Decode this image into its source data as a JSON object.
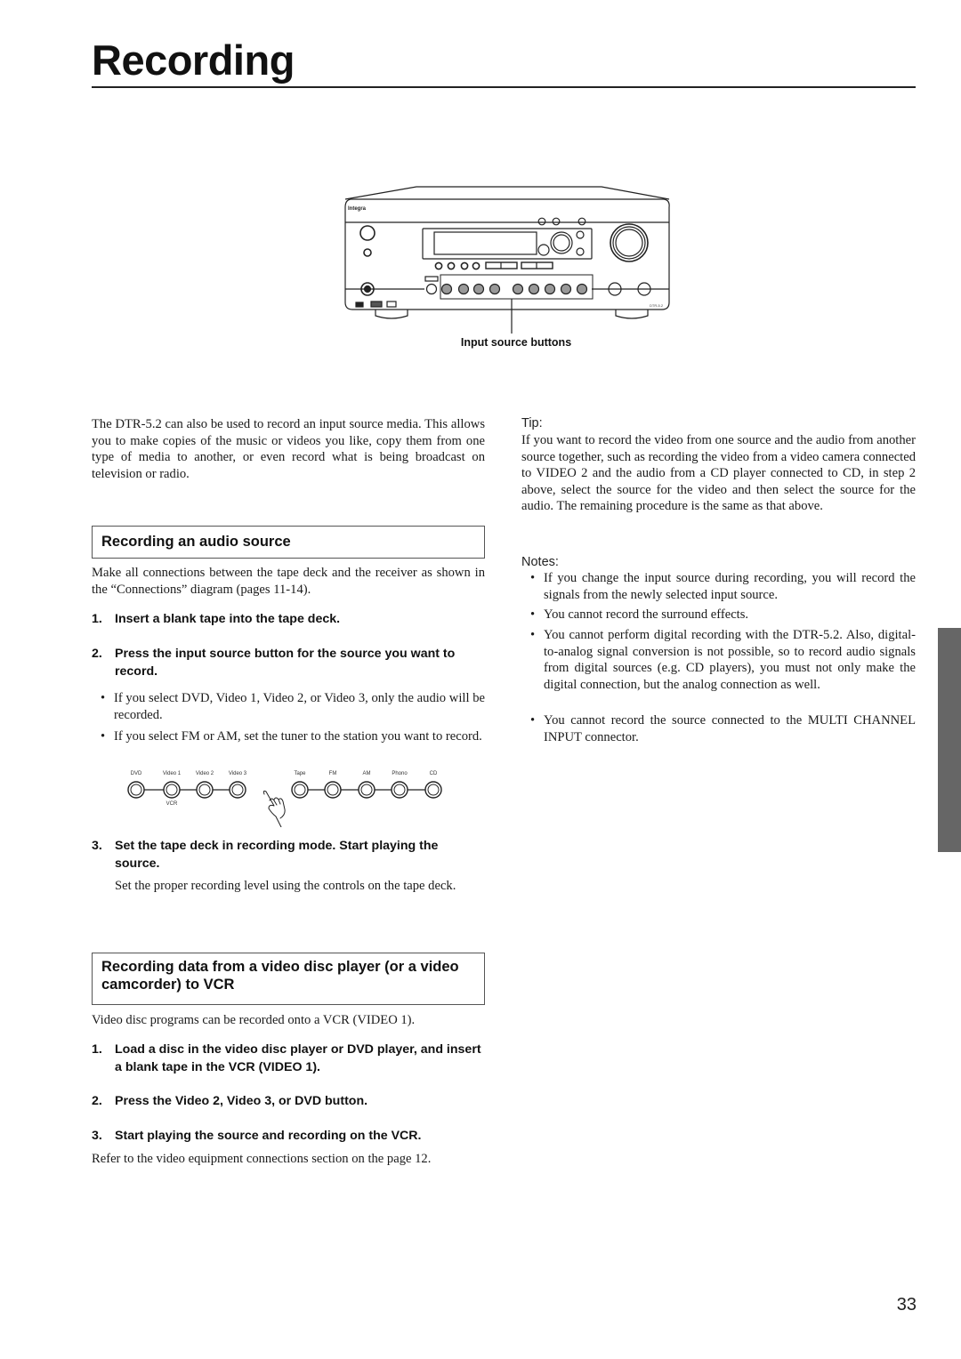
{
  "page": {
    "title": "Recording",
    "page_number": "33",
    "accent_tab_color": "#666666"
  },
  "figure_receiver": {
    "caption": "Input source buttons",
    "brand": "Integra",
    "model": "DTR-5.2",
    "input_buttons": [
      "DVD",
      "Video 1",
      "Video 2",
      "Video 3",
      "Tape",
      "FM",
      "AM",
      "Phono",
      "CD"
    ]
  },
  "intro": {
    "text": "The DTR-5.2 can also be used to record an input source media. This allows you to make copies of the music or videos you like, copy them from one type of media to another, or even record what is being broadcast on television or radio."
  },
  "section_audio": {
    "heading": "Recording an audio source",
    "intro": "Make all connections between the tape deck and the receiver as shown in the “Connections” diagram (pages 11-14).",
    "steps": [
      {
        "num": "1.",
        "text": "Insert a blank tape into the tape deck."
      },
      {
        "num": "2.",
        "text": "Press the input source button for the source you want to record."
      },
      {
        "num": "3.",
        "text": "Set the tape deck in recording mode. Start playing the source."
      }
    ],
    "step2_bullets": [
      "If you select DVD, Video 1, Video 2, or Video 3, only the audio will be recorded.",
      "If you select FM or AM, set the tuner to the station you want to record."
    ],
    "step3_detail": "Set the proper recording level using the controls on the tape deck.",
    "button_row": {
      "labels": [
        "DVD",
        "Video 1",
        "Video 2",
        "Video 3",
        "Tape",
        "FM",
        "AM",
        "Phono",
        "CD"
      ],
      "sublabel": "VCR"
    }
  },
  "section_video": {
    "heading": "Recording data from a video disc player (or a video camcorder) to VCR",
    "intro": "Video disc programs can be recorded onto a VCR (VIDEO 1).",
    "steps": [
      {
        "num": "1.",
        "text": "Load a disc in the video disc player or DVD player, and insert a blank tape in the VCR (VIDEO 1)."
      },
      {
        "num": "2.",
        "text": "Press the Video 2, Video 3, or DVD button."
      },
      {
        "num": "3.",
        "text": "Start playing the source and recording on the VCR."
      }
    ],
    "footer": "Refer to the video equipment connections section on the page 12."
  },
  "tip": {
    "label": "Tip:",
    "text": "If you want to record the video from one source and the audio from another source together, such as recording the video from a video camera connected to VIDEO 2 and the audio from a CD player connected to CD, in step 2 above, select the source for the video and then select the source for the audio. The remaining procedure is the same as that above."
  },
  "notes": {
    "label": "Notes:",
    "items": [
      "If you change the input source during recording, you will record the signals from the newly selected input source.",
      "You cannot record the surround effects.",
      "You cannot perform digital recording with the DTR-5.2. Also, digital-to-analog signal conversion is not possible, so to record audio signals from digital sources (e.g. CD players), you must not only make the digital connection, but the analog connection as well.",
      "You cannot record the source connected to the MULTI CHANNEL INPUT connector."
    ]
  }
}
